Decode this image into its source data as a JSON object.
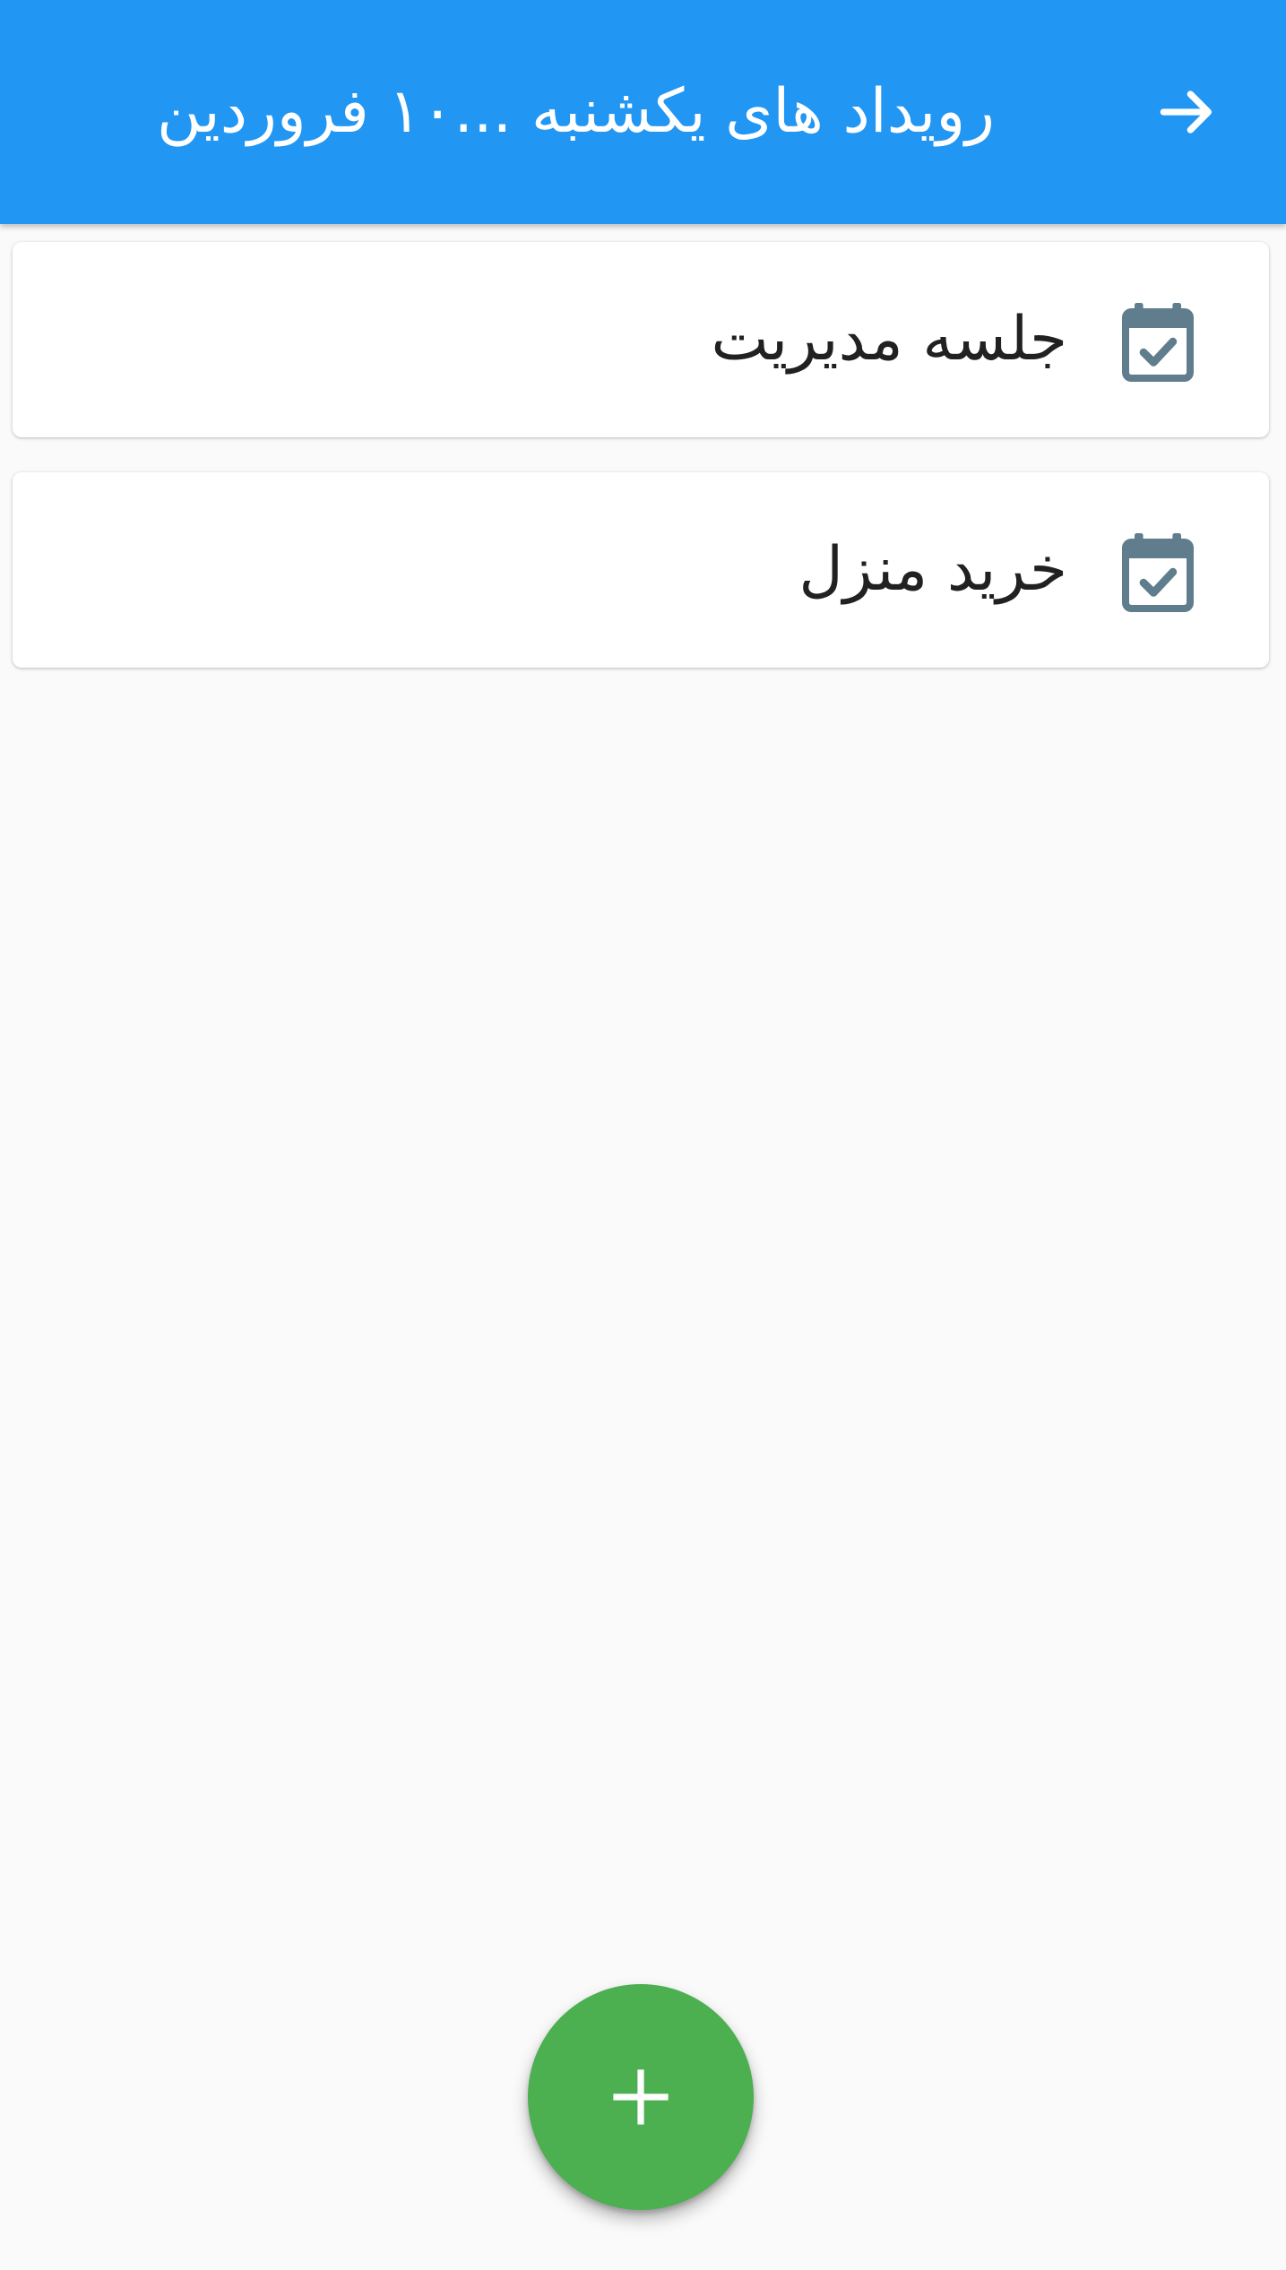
{
  "app_bar": {
    "title": "رویداد های یکشنبه ...۱۰ فروردین",
    "back_icon": "arrow-forward-icon",
    "background_color": "#2196f3",
    "title_color": "#ffffff"
  },
  "events": [
    {
      "title": "جلسه مدیریت",
      "icon": "event-available-icon"
    },
    {
      "title": "خرید منزل",
      "icon": "event-available-icon"
    }
  ],
  "fab": {
    "icon": "add-icon",
    "color": "#4caf50"
  },
  "colors": {
    "background": "#fafafa",
    "card": "#ffffff",
    "icon": "#5f7d8c",
    "text": "#212121"
  }
}
